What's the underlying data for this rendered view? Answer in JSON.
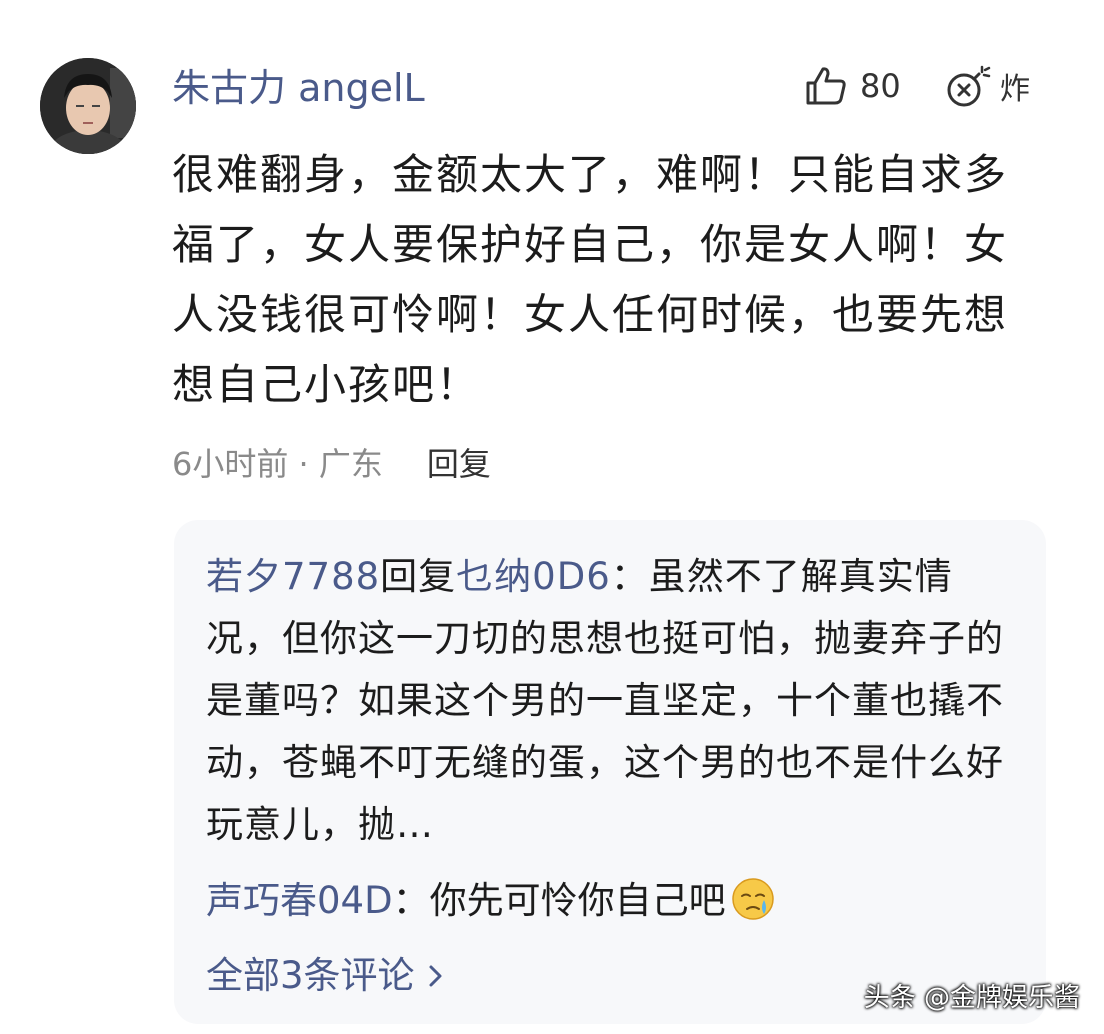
{
  "comment": {
    "username": "朱古力 angelL",
    "like_count": "80",
    "bomb_label": "炸",
    "text": "很难翻身，金额太大了，难啊！只能自求多福了，女人要保护好自己，你是女人啊！女人没钱很可怜啊！女人任何时候，也要先想想自己小孩吧！",
    "time": "6小时前",
    "separator": " · ",
    "location": "广东",
    "reply_label": "回复",
    "icons": {
      "avatar": "user-avatar-photo",
      "like": "thumbs-up-icon",
      "bomb": "bomb-icon"
    }
  },
  "replies": {
    "items": [
      {
        "author": "若夕7788",
        "reply_word": "回复",
        "reply_to": "乜纳0D6",
        "colon": "：",
        "text": "虽然不了解真实情况，但你这一刀切的思想也挺可怕，抛妻弃子的是董吗？如果这个男的一直坚定，十个董也撬不动，苍蝇不叮无缝的蛋，这个男的也不是什么好玩意儿，抛…"
      },
      {
        "author": "声巧春04D",
        "colon": "：",
        "text": "你先可怜你自己吧",
        "emoji": "crying-face-emoji"
      }
    ],
    "view_all": "全部3条评论",
    "view_all_icon": "chevron-right-icon"
  },
  "watermark": "头条 @金牌娱乐酱",
  "colors": {
    "link": "#4a5a8a",
    "text": "#1c1c1c",
    "meta": "#8a8a8a",
    "panel_bg": "#f7f8fa"
  }
}
